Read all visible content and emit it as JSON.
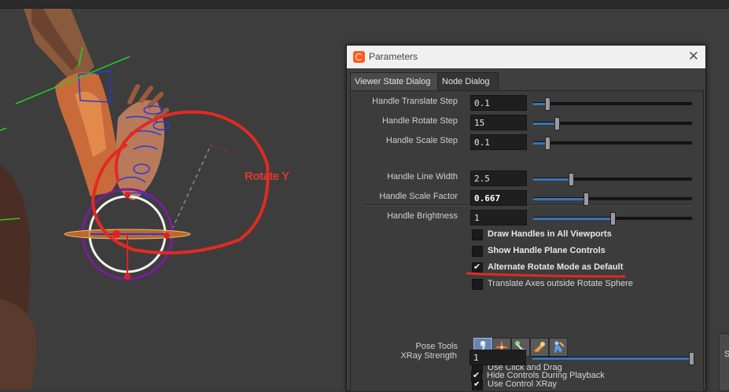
{
  "viewport": {
    "annotation_label": "Rotate Y"
  },
  "right_panel": {
    "fragment_text": "S"
  },
  "dialog": {
    "title": "Parameters",
    "close_icon": "close-icon",
    "logo_icon": "houdini-logo-icon",
    "tabs": [
      {
        "label": "Viewer State Dialog",
        "active": true
      },
      {
        "label": "Node Dialog",
        "active": false
      }
    ],
    "params": {
      "handle_translate_step": {
        "label": "Handle Translate Step",
        "value": "0.1",
        "slider_fraction": 0.09
      },
      "handle_rotate_step": {
        "label": "Handle Rotate Step",
        "value": "15",
        "slider_fraction": 0.15
      },
      "handle_scale_step": {
        "label": "Handle Scale Step",
        "value": "0.1",
        "slider_fraction": 0.09
      },
      "handle_line_width": {
        "label": "Handle Line Width",
        "value": "2.5",
        "slider_fraction": 0.24
      },
      "handle_scale_factor": {
        "label": "Handle Scale Factor",
        "value": "0.667",
        "slider_fraction": 0.33
      },
      "handle_brightness": {
        "label": "Handle Brightness",
        "value": "1",
        "slider_fraction": 0.5
      },
      "xray_strength": {
        "label": "XRay Strength",
        "value": "1",
        "slider_fraction": 1.0
      }
    },
    "checkboxes": {
      "draw_handles_all_viewports": {
        "label": "Draw Handles in All Viewports",
        "checked": false
      },
      "show_handle_plane_controls": {
        "label": "Show Handle Plane Controls",
        "checked": false
      },
      "alternate_rotate_mode_default": {
        "label": "Alternate Rotate Mode as Default",
        "checked": true
      },
      "translate_axes_outside_sphere": {
        "label": "Translate Axes outside Rotate Sphere",
        "checked": false
      },
      "use_click_and_drag": {
        "label": "Use Click and Drag",
        "checked": false
      },
      "use_control_xray": {
        "label": "Use Control XRay",
        "checked": true
      },
      "hide_controls_during_playback": {
        "label": "Hide Controls During Playback",
        "checked": true
      }
    },
    "pose_tools": {
      "label": "Pose Tools",
      "tools": [
        "pose-select-icon",
        "pose-translate-icon",
        "pose-ik-icon",
        "pose-twist-icon",
        "pose-figure-icon"
      ],
      "active_index": 0
    }
  },
  "colors": {
    "accent": "#3a73b8",
    "annotation_red": "#e0372f",
    "dialog_bg": "#3f3f3f",
    "titlebar_bg": "#f0f0f0"
  }
}
